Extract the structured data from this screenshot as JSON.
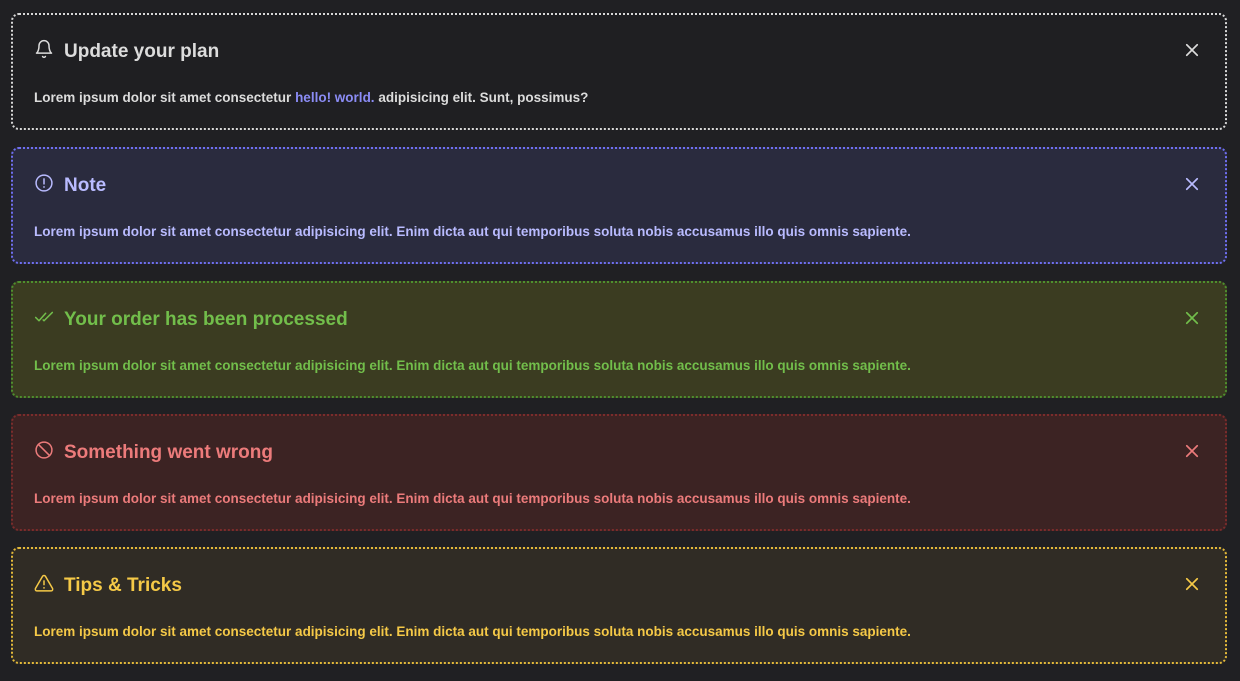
{
  "alerts": [
    {
      "title": "Update your plan",
      "body_before": "Lorem ipsum dolor sit amet consectetur ",
      "link": "hello! world.",
      "body_after": " adipisicing elit. Sunt, possimus?",
      "icon": "bell-icon",
      "color": "#dcdcdc"
    },
    {
      "title": "Note",
      "body": "Lorem ipsum dolor sit amet consectetur adipisicing elit. Enim dicta aut qui temporibus soluta nobis accusamus illo quis omnis sapiente.",
      "icon": "info-circle-icon",
      "color": "#b9bbff"
    },
    {
      "title": "Your order has been processed",
      "body": "Lorem ipsum dolor sit amet consectetur adipisicing elit. Enim dicta aut qui temporibus soluta nobis accusamus illo quis omnis sapiente.",
      "icon": "double-check-icon",
      "color": "#72be4b"
    },
    {
      "title": "Something went wrong",
      "body": "Lorem ipsum dolor sit amet consectetur adipisicing elit. Enim dicta aut qui temporibus soluta nobis accusamus illo quis omnis sapiente.",
      "icon": "ban-icon",
      "color": "#ec7b7b"
    },
    {
      "title": "Tips & Tricks",
      "body": "Lorem ipsum dolor sit amet consectetur adipisicing elit. Enim dicta aut qui temporibus soluta nobis accusamus illo quis omnis sapiente.",
      "icon": "warning-triangle-icon",
      "color": "#f5c947"
    }
  ],
  "close_icon": "close-icon"
}
